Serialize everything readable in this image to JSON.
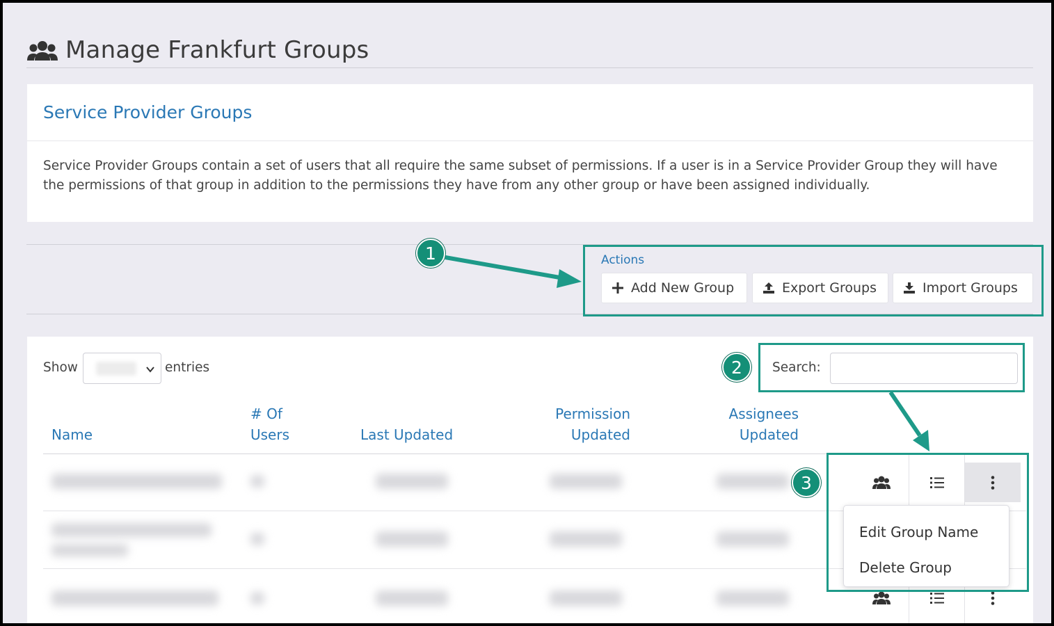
{
  "page": {
    "title": "Manage Frankfurt Groups"
  },
  "card": {
    "title": "Service Provider Groups",
    "description": "Service Provider Groups contain a set of users that all require the same subset of permissions. If a user is in a Service Provider Group they will have the permissions of that group in addition to the permissions they have from any other group or have been assigned individually."
  },
  "actions": {
    "label": "Actions",
    "add": "Add New Group",
    "export": "Export Groups",
    "import": "Import Groups"
  },
  "table_controls": {
    "show": "Show",
    "entries": "entries",
    "search": "Search:"
  },
  "table": {
    "headers": {
      "name": "Name",
      "users_line1": "# Of",
      "users_line2": "Users",
      "last_updated": "Last Updated",
      "permission_line1": "Permission",
      "permission_line2": "Updated",
      "assignees_line1": "Assignees",
      "assignees_line2": "Updated"
    }
  },
  "row_menu": {
    "edit": "Edit Group Name",
    "delete": "Delete Group"
  },
  "annotations": {
    "one": "1",
    "two": "2",
    "three": "3",
    "color": "#1e9a89"
  },
  "colors": {
    "accent": "#2a78b5",
    "background": "#ecebf2"
  },
  "icons": {
    "page": "users-icon",
    "add": "plus-icon",
    "export": "upload-icon",
    "import": "download-icon",
    "members": "users-icon",
    "permissions": "list-icon",
    "more": "vertical-dots-icon"
  }
}
